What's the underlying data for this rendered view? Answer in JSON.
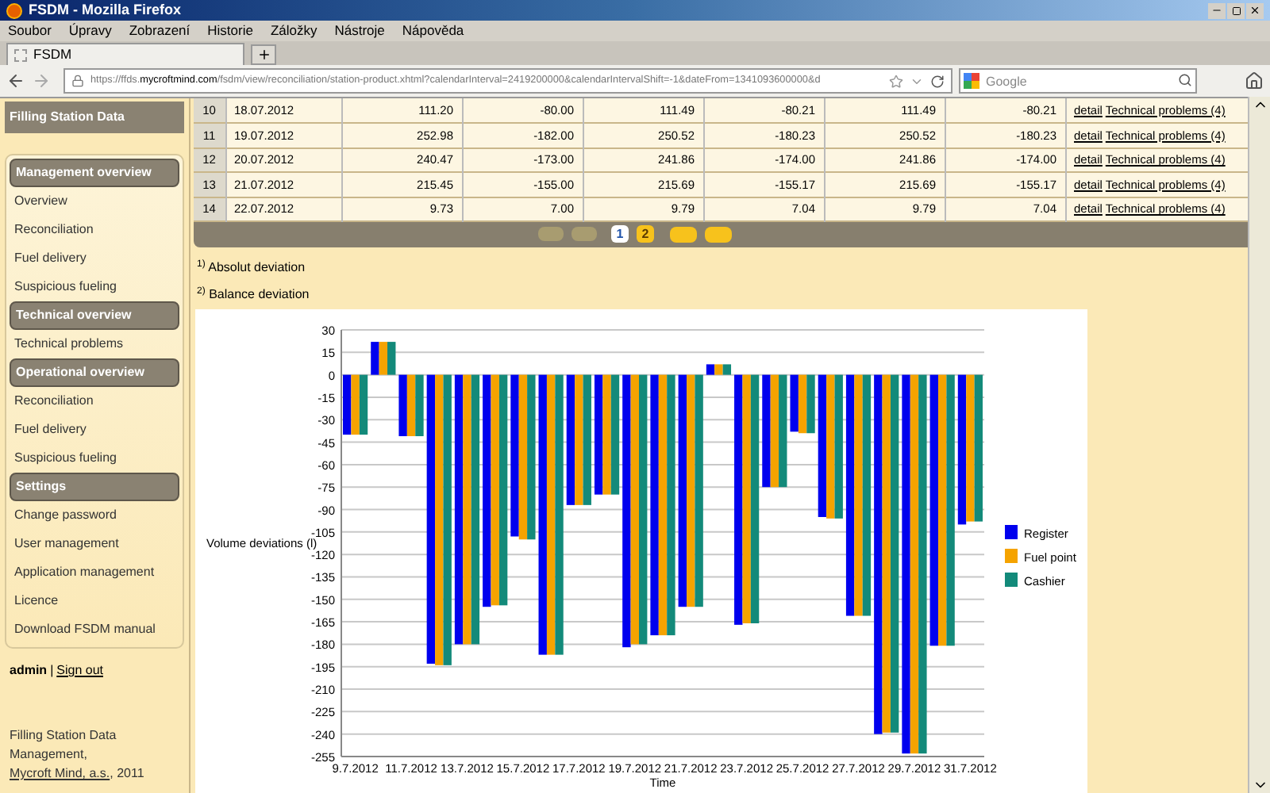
{
  "window": {
    "title": "FSDM - Mozilla Firefox"
  },
  "menu": [
    "Soubor",
    "Úpravy",
    "Zobrazení",
    "Historie",
    "Záložky",
    "Nástroje",
    "Nápověda"
  ],
  "tabs": [
    {
      "label": "FSDM",
      "selected": true
    }
  ],
  "address": {
    "prefix": "https://ffds.",
    "domain": "mycroftmind.com",
    "rest": "/fsdm/view/reconciliation/station-product.xhtml?calendarInterval=2419200000&calendarIntervalShift=-1&dateFrom=1341093600000&d"
  },
  "search": {
    "placeholder": "Google"
  },
  "sidebar": {
    "title": "Filling Station Data",
    "groups": [
      {
        "title": "Management overview",
        "items": [
          "Overview",
          "Reconciliation",
          "Fuel delivery",
          "Suspicious fueling"
        ]
      },
      {
        "title": "Technical overview",
        "items": [
          "Technical problems"
        ]
      },
      {
        "title": "Operational overview",
        "items": [
          "Reconciliation",
          "Fuel delivery",
          "Suspicious fueling"
        ]
      },
      {
        "title": "Settings",
        "items": [
          "Change password",
          "User management",
          "Application management",
          "Licence",
          "Download FSDM manual"
        ]
      }
    ],
    "user": "admin",
    "separator": "|",
    "sign_out": "Sign out",
    "footer": {
      "text": "Filling Station Data Management,",
      "company": "Mycroft Mind, a.s.",
      "year": ", 2011"
    }
  },
  "table": {
    "rows": [
      {
        "column_1": "10",
        "column_2": "18.07.2012",
        "column_3": "111.20",
        "column_4": "-80.00",
        "column_5": "111.49",
        "column_6": "-80.21",
        "column_7": "111.49",
        "column_8": "-80.21",
        "detail": "detail",
        "problems": "Technical problems (4)"
      },
      {
        "column_1": "11",
        "column_2": "19.07.2012",
        "column_3": "252.98",
        "column_4": "-182.00",
        "column_5": "250.52",
        "column_6": "-180.23",
        "column_7": "250.52",
        "column_8": "-180.23",
        "detail": "detail",
        "problems": "Technical problems (4)"
      },
      {
        "column_1": "12",
        "column_2": "20.07.2012",
        "column_3": "240.47",
        "column_4": "-173.00",
        "column_5": "241.86",
        "column_6": "-174.00",
        "column_7": "241.86",
        "column_8": "-174.00",
        "detail": "detail",
        "problems": "Technical problems (4)"
      },
      {
        "column_1": "13",
        "column_2": "21.07.2012",
        "column_3": "215.45",
        "column_4": "-155.00",
        "column_5": "215.69",
        "column_6": "-155.17",
        "column_7": "215.69",
        "column_8": "-155.17",
        "detail": "detail",
        "problems": "Technical problems (4)"
      },
      {
        "column_1": "14",
        "column_2": "22.07.2012",
        "column_3": "9.73",
        "column_4": "7.00",
        "column_5": "9.79",
        "column_6": "7.04",
        "column_7": "9.79",
        "column_8": "7.04",
        "detail": "detail",
        "problems": "Technical problems (4)"
      }
    ],
    "pages": [
      {
        "label": "1",
        "selected": true
      },
      {
        "label": "2",
        "selected": false
      }
    ]
  },
  "footnotes": [
    {
      "mark": "1)",
      "text": "Absolut deviation"
    },
    {
      "mark": "2)",
      "text": "Balance deviation"
    }
  ],
  "chart": {
    "chart_data": {
      "type": "bar",
      "xlabel": "Time",
      "ylabel": "Volume deviations (l)",
      "categories": [
        "9.7.2012",
        null,
        "11.7.2012",
        null,
        "13.7.2012",
        null,
        "15.7.2012",
        null,
        "17.7.2012",
        null,
        "19.7.2012",
        null,
        "21.7.2012",
        null,
        "23.7.2012",
        null,
        "25.7.2012",
        null,
        "27.7.2012",
        null,
        "29.7.2012",
        null,
        "31.7.2012"
      ],
      "grid": true,
      "legend": "right",
      "stacked": false,
      "series": [
        {
          "name": "Register",
          "color": "#0000ee",
          "values": [
            -40,
            22,
            -41,
            -193,
            -180,
            -155,
            -108,
            -187,
            -87,
            -80,
            -182,
            -174,
            -155,
            7,
            -167,
            -75,
            -38,
            -95,
            -161,
            -240,
            -253,
            -181,
            -100
          ]
        },
        {
          "name": "Fuel point",
          "color": "#f5a300",
          "values": [
            -40,
            22,
            -41,
            -194,
            -180,
            -154,
            -110,
            -187,
            -87,
            -80,
            -180,
            -174,
            -155,
            7,
            -166,
            -75,
            -39,
            -96,
            -161,
            -239,
            -253,
            -181,
            -98
          ]
        },
        {
          "name": "Cashier",
          "color": "#138a7a",
          "values": [
            -40,
            22,
            -41,
            -194,
            -180,
            -154,
            -110,
            -187,
            -87,
            -80,
            -180,
            -174,
            -155,
            7,
            -166,
            -75,
            -39,
            -96,
            -161,
            -239,
            -253,
            -181,
            -98
          ]
        }
      ],
      "ylim": [
        -255,
        30
      ],
      "yticks": [
        30,
        15,
        0,
        -15,
        -30,
        -45,
        -60,
        -75,
        -90,
        -105,
        -120,
        -135,
        -150,
        -165,
        -180,
        -195,
        -210,
        -225,
        -240,
        -255
      ]
    }
  }
}
